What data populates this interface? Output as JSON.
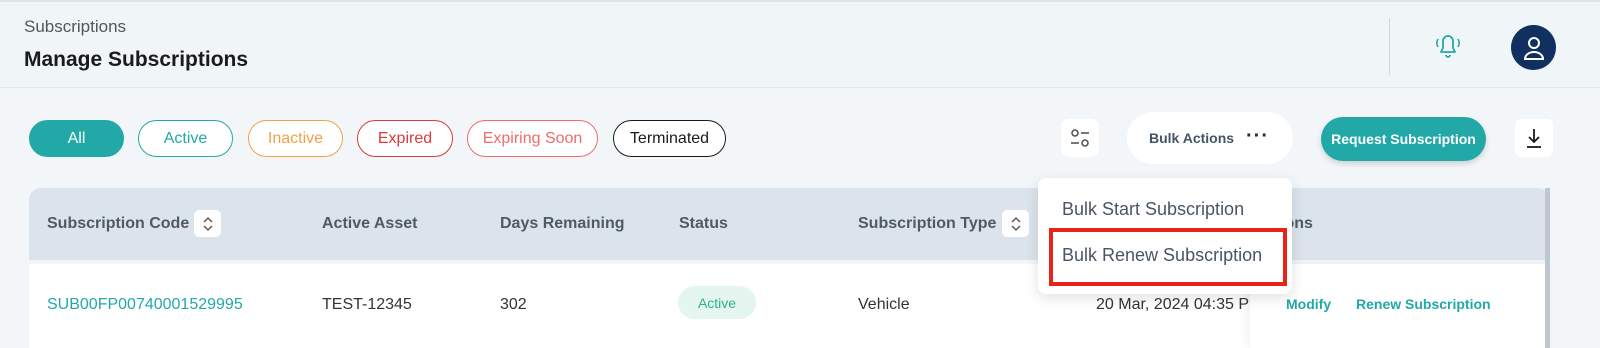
{
  "header": {
    "breadcrumb": "Subscriptions",
    "title": "Manage Subscriptions",
    "icons": [
      "bell-icon",
      "user-avatar-icon"
    ]
  },
  "filters": {
    "chips": [
      "All",
      "Active",
      "Inactive",
      "Expired",
      "Expiring Soon",
      "Terminated"
    ],
    "selected": "All"
  },
  "toolbar": {
    "bulk_actions_label": "Bulk Actions",
    "bulk_more": "···",
    "request_label": "Request Subscription"
  },
  "bulk_menu": {
    "items": [
      "Bulk Start Subscription",
      "Bulk Renew Subscription"
    ],
    "highlighted": "Bulk Renew Subscription"
  },
  "table": {
    "columns": [
      "Subscription Code",
      "Active Asset",
      "Days Remaining",
      "Status",
      "Subscription Type",
      "",
      "Actions"
    ],
    "actions_header_visible": "ions",
    "rows": [
      {
        "code": "SUB00FP00740001529995",
        "asset": "TEST-12345",
        "days": "302",
        "status": "Active",
        "type": "Vehicle",
        "date": "20 Mar, 2024 04:35 P",
        "actions": [
          "Modify",
          "Renew Subscription"
        ]
      }
    ]
  },
  "colors": {
    "accent": "#23a8a8",
    "inactive": "#f0a04b",
    "expired": "#d93a3a",
    "expiring": "#ee6b6b",
    "highlight": "#e8241a",
    "avatar": "#10305f"
  }
}
